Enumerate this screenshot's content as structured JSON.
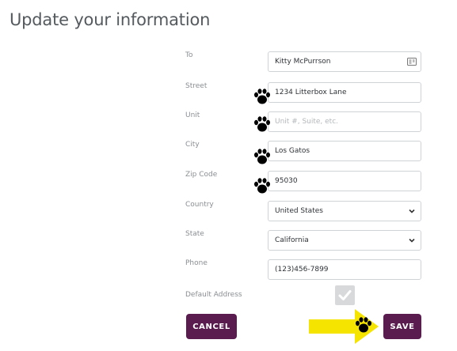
{
  "page": {
    "title": "Update your information"
  },
  "form": {
    "fields": [
      {
        "label": "To",
        "value": "Kitty McPurrson",
        "placeholder": ""
      },
      {
        "label": "Street",
        "value": "1234 Litterbox Lane",
        "placeholder": ""
      },
      {
        "label": "Unit",
        "value": "",
        "placeholder": "Unit #, Suite, etc."
      },
      {
        "label": "City",
        "value": "Los Gatos",
        "placeholder": ""
      },
      {
        "label": "Zip Code",
        "value": "95030",
        "placeholder": ""
      },
      {
        "label": "Country",
        "value": "United States",
        "placeholder": ""
      },
      {
        "label": "State",
        "value": "California",
        "placeholder": ""
      },
      {
        "label": "Phone",
        "value": "(123)456-7899",
        "placeholder": ""
      }
    ],
    "default_address": {
      "label": "Default Address",
      "checked": true
    }
  },
  "actions": {
    "cancel_label": "CANCEL",
    "save_label": "SAVE"
  },
  "colors": {
    "button": "#5a1b4e",
    "arrow": "#f5e400",
    "paw": "#000000",
    "checkbox": "#d7d9db"
  },
  "icons": [
    "contact-card-icon",
    "chevron-down-icon",
    "paw-icon",
    "checkmark-icon",
    "arrow-icon"
  ]
}
